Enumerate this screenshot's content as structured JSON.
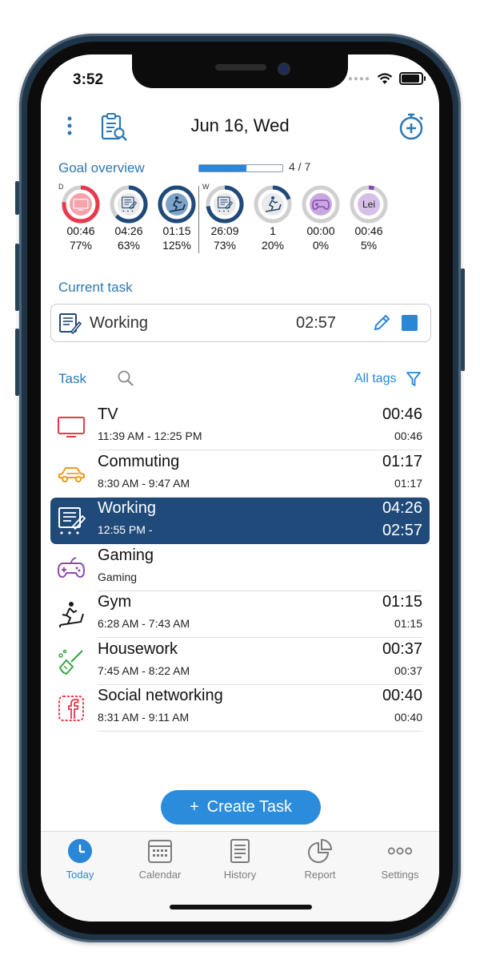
{
  "status": {
    "time": "3:52"
  },
  "header": {
    "date": "Jun 16, Wed",
    "menu_icon": "more-vertical-icon",
    "report_icon": "clipboard-search-icon",
    "timer_icon": "add-timer-icon"
  },
  "goal_overview": {
    "title": "Goal overview",
    "progress_label": "4 / 7",
    "progress_fraction": 0.57,
    "daily_marker": "D",
    "weekly_marker": "W",
    "rings": [
      {
        "value": "00:46",
        "percent": "77%",
        "fraction": 0.77,
        "color": "#e8394d",
        "bg": "#f5a3ab",
        "icon": "tv-icon",
        "icon_text": ""
      },
      {
        "value": "04:26",
        "percent": "63%",
        "fraction": 0.63,
        "color": "#1f4a79",
        "bg": "#eaeaea",
        "icon": "working-icon",
        "icon_text": ""
      },
      {
        "value": "01:15",
        "percent": "125%",
        "fraction": 1.0,
        "color": "#1f4a79",
        "bg": "#7fa3c6",
        "icon": "gym-icon",
        "icon_text": ""
      },
      {
        "value": "26:09",
        "percent": "73%",
        "fraction": 0.73,
        "color": "#1f4a79",
        "bg": "#eaeaea",
        "icon": "working-icon",
        "icon_text": ""
      },
      {
        "value": "1",
        "percent": "20%",
        "fraction": 0.2,
        "color": "#1f4a79",
        "bg": "#eaeaea",
        "icon": "gym-icon",
        "icon_text": ""
      },
      {
        "value": "00:00",
        "percent": "0%",
        "fraction": 0.0,
        "color": "#8a4bb0",
        "bg": "#c9a8e0",
        "icon": "gaming-icon",
        "icon_text": ""
      },
      {
        "value": "00:46",
        "percent": "5%",
        "fraction": 0.05,
        "color": "#8a4bb0",
        "bg": "#d6bfe8",
        "icon": "leisure-icon",
        "icon_text": "Lei"
      }
    ]
  },
  "current_task": {
    "title": "Current task",
    "name": "Working",
    "time": "02:57"
  },
  "task_section": {
    "title": "Task",
    "filter_label": "All tags"
  },
  "tasks": [
    {
      "name": "TV",
      "range": "11:39 AM - 12:25 PM",
      "duration": "00:46",
      "duration_sub": "00:46",
      "icon": "tv-icon",
      "active": false
    },
    {
      "name": "Commuting",
      "range": "8:30 AM - 9:47 AM",
      "duration": "01:17",
      "duration_sub": "01:17",
      "icon": "car-icon",
      "active": false
    },
    {
      "name": "Working",
      "range": "12:55 PM -",
      "duration": "04:26",
      "duration_sub": "02:57",
      "icon": "working-icon",
      "active": true
    },
    {
      "name": "Gaming",
      "range": "Gaming",
      "duration": "",
      "duration_sub": "",
      "icon": "gamepad-icon",
      "active": false
    },
    {
      "name": "Gym",
      "range": "6:28 AM - 7:43 AM",
      "duration": "01:15",
      "duration_sub": "01:15",
      "icon": "treadmill-icon",
      "active": false
    },
    {
      "name": "Housework",
      "range": "7:45 AM - 8:22 AM",
      "duration": "00:37",
      "duration_sub": "00:37",
      "icon": "broom-icon",
      "active": false
    },
    {
      "name": "Social networking",
      "range": "8:31 AM - 9:11 AM",
      "duration": "00:40",
      "duration_sub": "00:40",
      "icon": "facebook-icon",
      "active": false
    }
  ],
  "create_button": {
    "plus": "+",
    "label": "Create Task"
  },
  "tabbar": {
    "today": "Today",
    "calendar": "Calendar",
    "history": "History",
    "report": "Report",
    "settings": "Settings"
  }
}
